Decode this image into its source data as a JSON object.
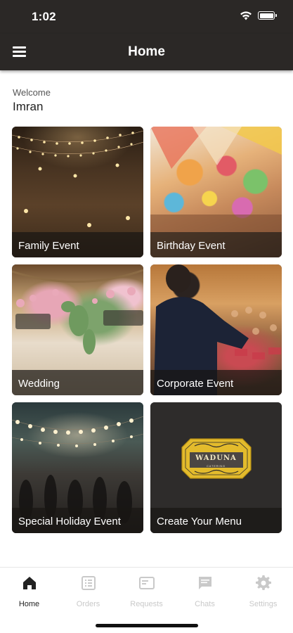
{
  "status_bar": {
    "time": "1:02",
    "icons": [
      "wifi-icon",
      "battery-icon"
    ]
  },
  "app_bar": {
    "title": "Home",
    "menu_icon": "hamburger-menu-icon"
  },
  "welcome": {
    "label": "Welcome",
    "name": "Imran"
  },
  "categories": [
    {
      "label": "Family Event"
    },
    {
      "label": "Birthday Event"
    },
    {
      "label": "Wedding"
    },
    {
      "label": "Corporate Event"
    },
    {
      "label": "Special Holiday Event"
    },
    {
      "label": "Create Your Menu",
      "logo_text": "WADUNA",
      "logo_sub": "CATERING"
    }
  ],
  "tab_bar": {
    "tabs": [
      {
        "label": "Home",
        "icon": "home-icon",
        "active": true
      },
      {
        "label": "Orders",
        "icon": "orders-icon",
        "active": false
      },
      {
        "label": "Requests",
        "icon": "requests-icon",
        "active": false
      },
      {
        "label": "Chats",
        "icon": "chat-icon",
        "active": false
      },
      {
        "label": "Settings",
        "icon": "gear-icon",
        "active": false
      }
    ]
  },
  "colors": {
    "header_bg": "#2b2826",
    "card_caption_bg": "#191614",
    "logo_gold": "#e7c030",
    "active_tab": "#222222",
    "inactive_tab": "#c9c9c9"
  }
}
